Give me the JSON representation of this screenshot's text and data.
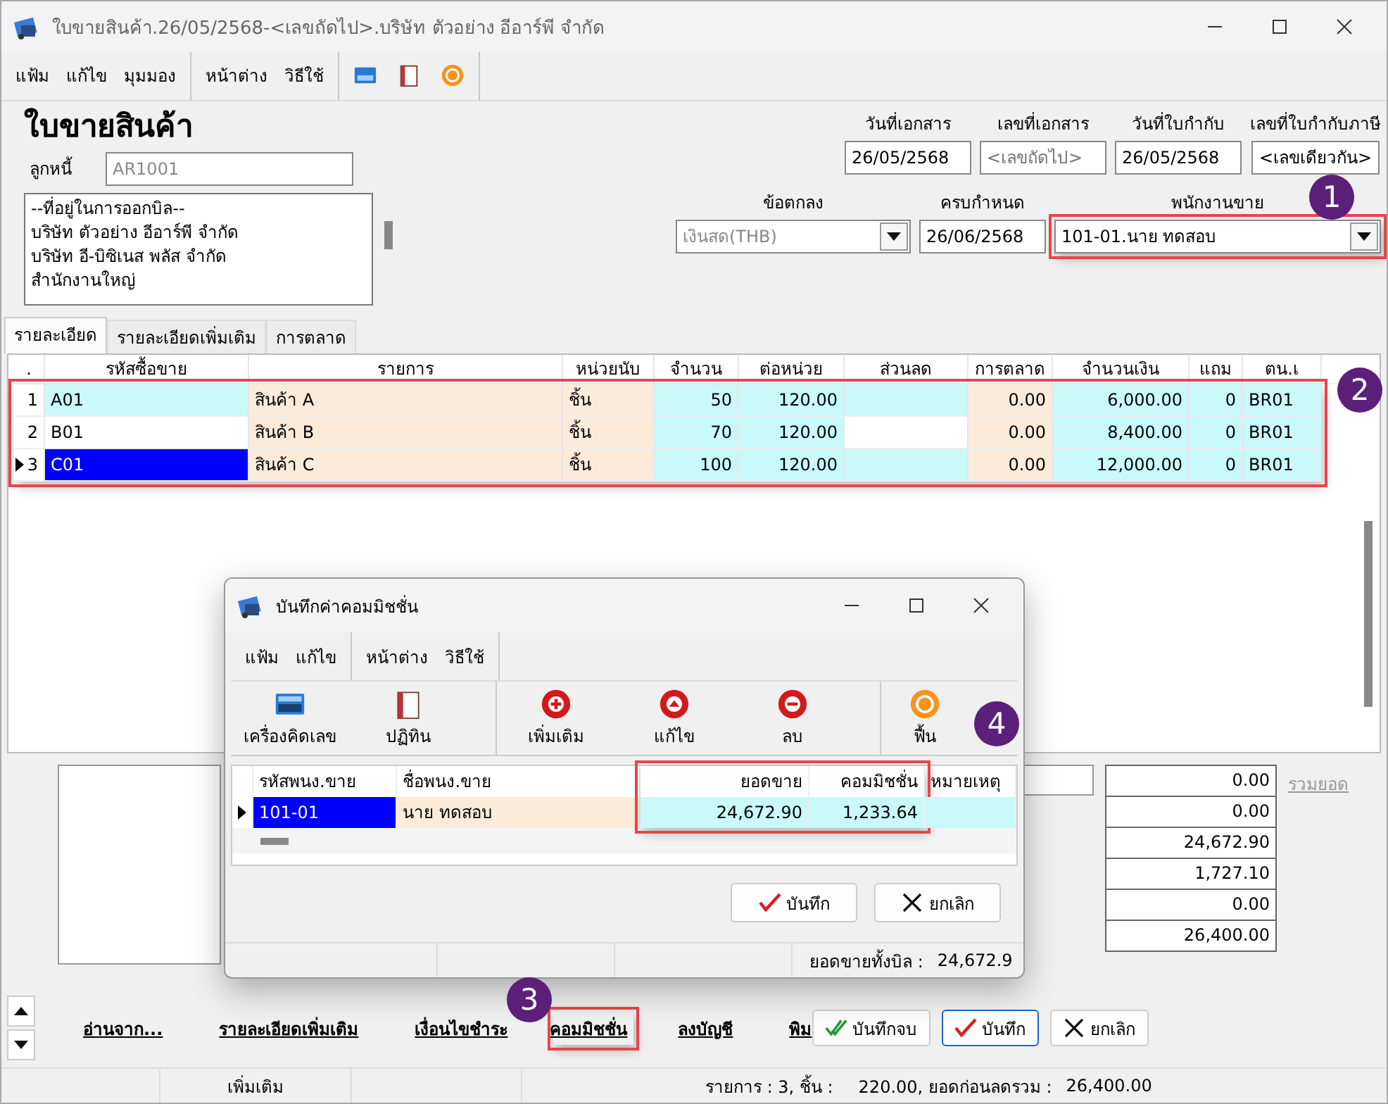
{
  "window": {
    "title": "ใบขายสินค้า.26/05/2568-<เลขถัดไป>.บริษัท ตัวอย่าง อีอาร์พี จำกัด"
  },
  "menu": {
    "groups": [
      [
        "แฟ้ม",
        "แก้ไข",
        "มุมมอง"
      ],
      [
        "หน้าต่าง",
        "วิธีใช้"
      ]
    ]
  },
  "form": {
    "heading": "ใบขายสินค้า",
    "debtor_label": "ลูกหนี้",
    "debtor": "AR1001",
    "address_lines": [
      "--ที่อยู่ในการออกบิล--",
      "บริษัท ตัวอย่าง อีอาร์พี จำกัด",
      "บริษัท อี-บิซิเนส พลัส จำกัด",
      "สำนักงานใหญ่"
    ],
    "doc_fields": [
      {
        "label": "วันที่เอกสาร",
        "value": "26/05/2568"
      },
      {
        "label": "เลขที่เอกสาร",
        "placeholder": "<เลขถัดไป>"
      },
      {
        "label": "วันที่ใบกำกับ",
        "value": "26/05/2568"
      },
      {
        "label": "เลขที่ใบกำกับภาษี",
        "value": "<เลขเดียวกัน>"
      }
    ],
    "terms": {
      "label": "ข้อตกลง",
      "value": "เงินสด(THB)",
      "disabled": true
    },
    "due": {
      "label": "ครบกำหนด",
      "value": "26/06/2568"
    },
    "salesperson": {
      "label": "พนักงานขาย",
      "value": "101-01.นาย ทดสอบ"
    }
  },
  "tabs": [
    {
      "label": "รายละเอียด",
      "selected": true
    },
    {
      "label": "รายละเอียดเพิ่มเติม",
      "selected": false
    },
    {
      "label": "การตลาด",
      "selected": false
    }
  ],
  "grid": {
    "columns": [
      ".",
      "รหัสซื้อขาย",
      "รายการ",
      "หน่วยนับ",
      "จำนวน",
      "ต่อหน่วย",
      "ส่วนลด",
      "การตลาด",
      "จำนวนเงิน",
      "แถม",
      "ตน.เ"
    ],
    "rows": [
      {
        "selected": false,
        "cells": [
          "1",
          "A01",
          "สินค้า A",
          "ชิ้น",
          "50",
          "120.00",
          "",
          "0.00",
          "6,000.00",
          "0",
          "BR01"
        ]
      },
      {
        "selected": false,
        "cells": [
          "2",
          "B01",
          "สินค้า B",
          "ชิ้น",
          "70",
          "120.00",
          "",
          "0.00",
          "8,400.00",
          "0",
          "BR01"
        ]
      },
      {
        "selected": true,
        "cells": [
          "3",
          "C01",
          "สินค้า C",
          "ชิ้น",
          "100",
          "120.00",
          "",
          "0.00",
          "12,000.00",
          "0",
          "BR01"
        ]
      }
    ]
  },
  "totals": {
    "values": [
      "0.00",
      "0.00",
      "24,672.90",
      "1,727.10",
      "0.00",
      "26,400.00"
    ],
    "link": {
      "label": "รวมยอด",
      "disabled": true
    }
  },
  "actions": {
    "links": [
      "อ่านจาก...",
      "รายละเอียดเพิ่มเติม",
      "เงื่อนไขชำระ",
      "คอมมิชชั่น",
      "ลงบัญชี",
      "พิม"
    ],
    "buttons": [
      {
        "label": "บันทึกจบ",
        "kind": "save-close"
      },
      {
        "label": "บันทึก",
        "kind": "save"
      },
      {
        "label": "ยกเลิก",
        "kind": "cancel"
      }
    ]
  },
  "status_bar": [
    "เพิ่มเติม",
    "รายการ : 3, ชิ้น :",
    "220.00, ยอดก่อนลดรวม :",
    "26,400.00"
  ],
  "dialog": {
    "title": "บันทึกค่าคอมมิชชั่น",
    "menu": [
      [
        "แฟ้ม",
        "แก้ไข"
      ],
      [
        "หน้าต่าง",
        "วิธีใช้"
      ]
    ],
    "tools": [
      {
        "label": "เครื่องคิดเลข",
        "kind": "calculator"
      },
      {
        "label": "ปฏิทิน",
        "kind": "calendar"
      },
      {
        "label": "เพิ่มเติม",
        "kind": "add"
      },
      {
        "label": "แก้ไข",
        "kind": "edit"
      },
      {
        "label": "ลบ",
        "kind": "delete"
      },
      {
        "label": "ฟื้น",
        "kind": "restore"
      }
    ],
    "columns": [
      "รหัสพนง.ขาย",
      "ชื่อพนง.ขาย",
      "ยอดขาย",
      "คอมมิชชั่น",
      "หมายเหตุ"
    ],
    "rows": [
      {
        "selected": true,
        "cells": [
          "101-01",
          "นาย ทดสอบ",
          "24,672.90",
          "1,233.64",
          ""
        ]
      }
    ],
    "buttons": [
      {
        "label": "บันทึก",
        "kind": "save"
      },
      {
        "label": "ยกเลิก",
        "kind": "cancel"
      }
    ],
    "total_label": "ยอดขายทั้งบิล :",
    "total": "24,672.9"
  },
  "annotations": [
    {
      "label": "1"
    },
    {
      "label": "2"
    },
    {
      "label": "3"
    },
    {
      "label": "4"
    }
  ]
}
